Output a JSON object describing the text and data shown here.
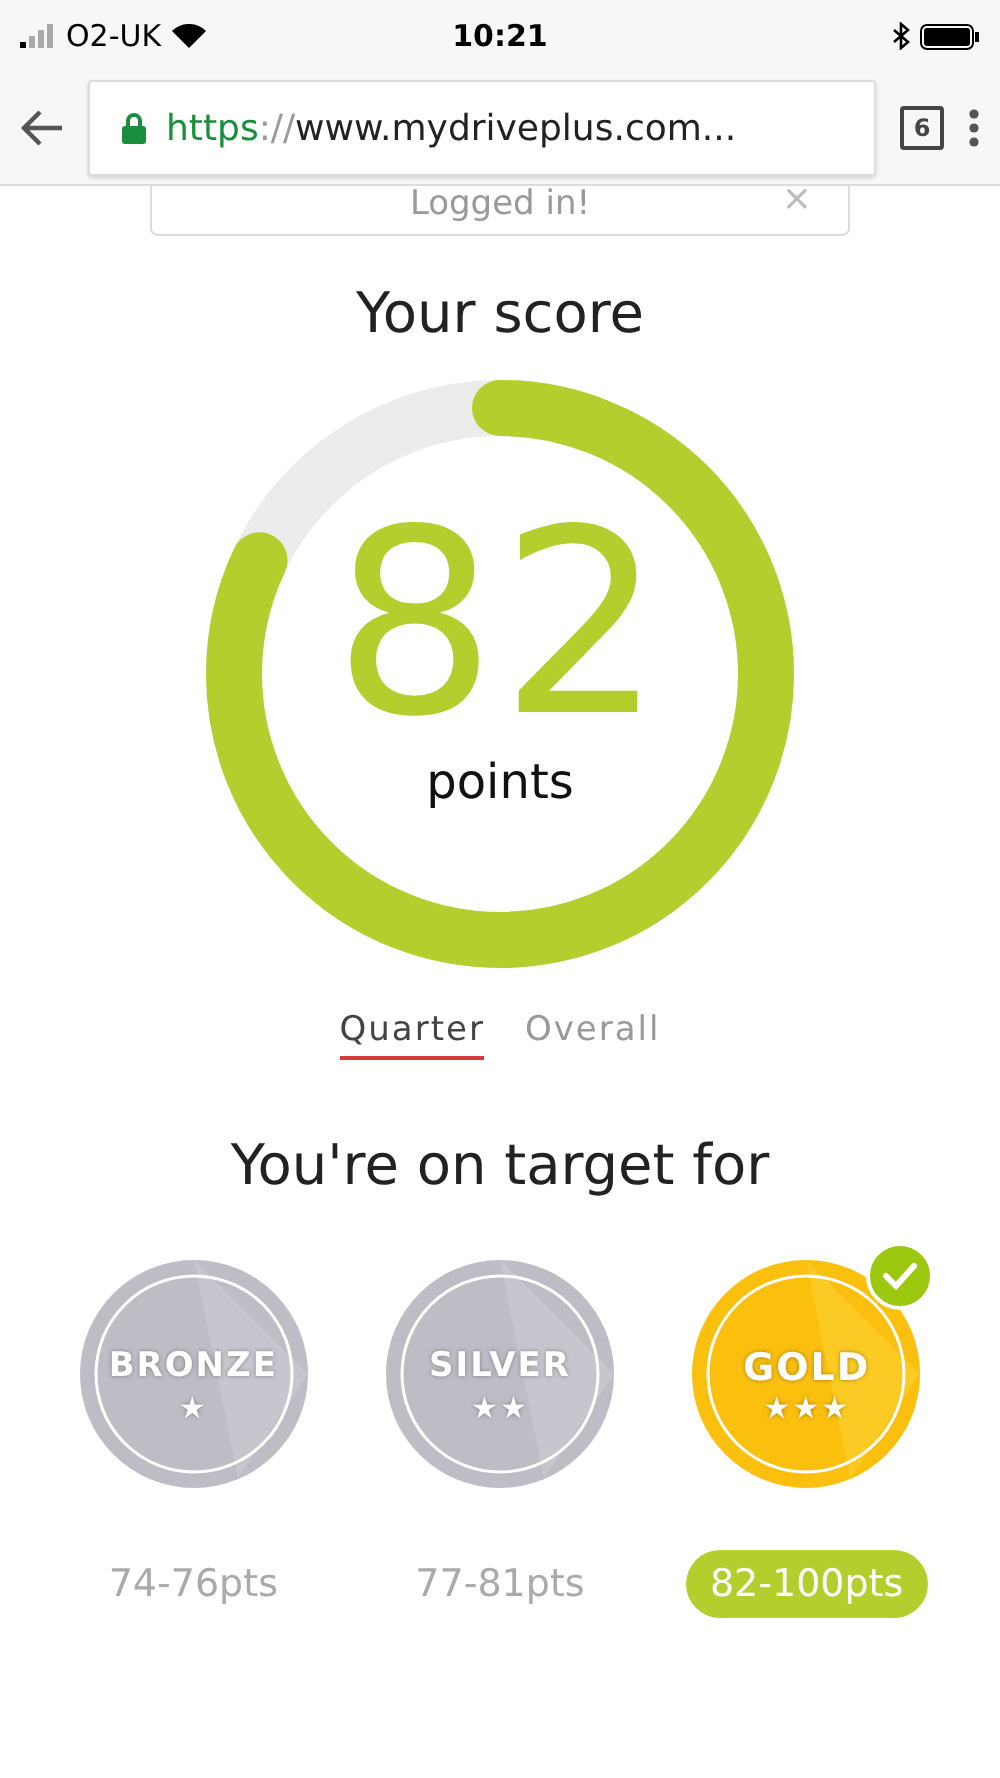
{
  "status_bar": {
    "carrier": "O2-UK",
    "time": "10:21"
  },
  "browser": {
    "url_scheme": "https",
    "url_sep": "://",
    "url_rest": "www.mydriveplus.com...",
    "tab_count": "6"
  },
  "notice": {
    "text": "Logged in!",
    "close": "×"
  },
  "score": {
    "title": "Your score",
    "value": "82",
    "unit": "points"
  },
  "tabs": [
    {
      "label": "Quarter",
      "selected": true
    },
    {
      "label": "Overall",
      "selected": false
    }
  ],
  "target": {
    "title": "You're on target for"
  },
  "badges": [
    {
      "name": "BRONZE",
      "stars_text": "★",
      "range": "74-76pts",
      "achieved": false
    },
    {
      "name": "SILVER",
      "stars_text": "★★",
      "range": "77-81pts",
      "achieved": false
    },
    {
      "name": "GOLD",
      "stars_text": "★★★",
      "range": "82-100pts",
      "achieved": true
    }
  ]
}
